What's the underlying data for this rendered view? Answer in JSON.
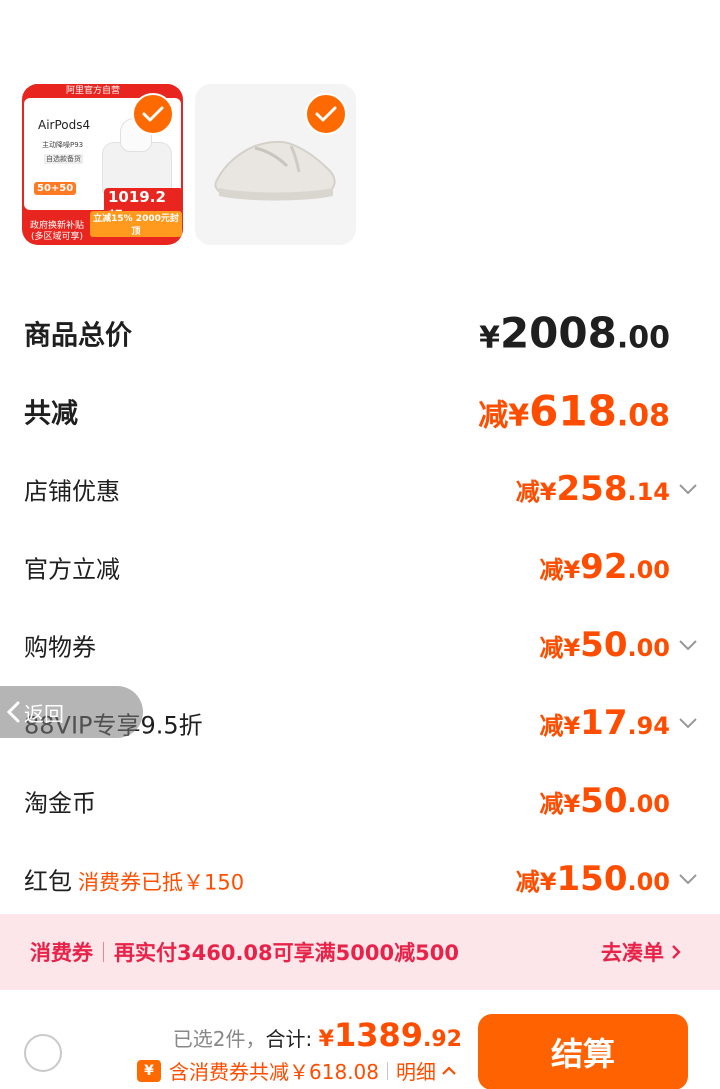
{
  "products": [
    {
      "ad": {
        "store_banner": "阿里官方自营",
        "name": "AirPods4",
        "subtitle": "主动降噪P93",
        "chip": "自选款备货",
        "badge": "50+50",
        "price": "1019.2起",
        "left_note": "政府换新补贴 (多区域可享)",
        "right_note": "立减15% 2000元封顶"
      }
    },
    {}
  ],
  "summary": {
    "total": {
      "label": "商品总价",
      "prefix": "¥",
      "int": "2008",
      "dec": ".00"
    },
    "reduce": {
      "label": "共减",
      "prefix": "减¥",
      "int": "618",
      "dec": ".08"
    },
    "items": [
      {
        "label": "店铺优惠",
        "sub": "",
        "prefix": "减¥",
        "int": "258",
        "dec": ".14",
        "expandable": true
      },
      {
        "label": "官方立减",
        "sub": "",
        "prefix": "减¥",
        "int": "92",
        "dec": ".00",
        "expandable": false
      },
      {
        "label": "购物券",
        "sub": "",
        "prefix": "减¥",
        "int": "50",
        "dec": ".00",
        "expandable": true
      },
      {
        "label": "88VIP专享9.5折",
        "sub": "",
        "prefix": "减¥",
        "int": "17",
        "dec": ".94",
        "expandable": true
      },
      {
        "label": "淘金币",
        "sub": "",
        "prefix": "减¥",
        "int": "50",
        "dec": ".00",
        "expandable": false
      },
      {
        "label": "红包",
        "sub": "消费券已抵￥150",
        "prefix": "减¥",
        "int": "150",
        "dec": ".00",
        "expandable": true
      }
    ]
  },
  "back_pill": {
    "label": "返回"
  },
  "coupon_bar": {
    "tag": "消费券",
    "message": "再实付3460.08可享满5000减500",
    "link": "去凑单"
  },
  "bottom_bar": {
    "selected": "已选2件，",
    "total_label": "合计: ",
    "price_prefix": "¥",
    "price_int": "1389",
    "price_dec": ".92",
    "yen_icon": "¥",
    "discount_text": "含消费券共减￥618.08",
    "detail": "明细",
    "checkout": "结算"
  },
  "colors": {
    "accent": "#ff6200",
    "price": "#ff4d00",
    "coupon": "#e8234a"
  }
}
